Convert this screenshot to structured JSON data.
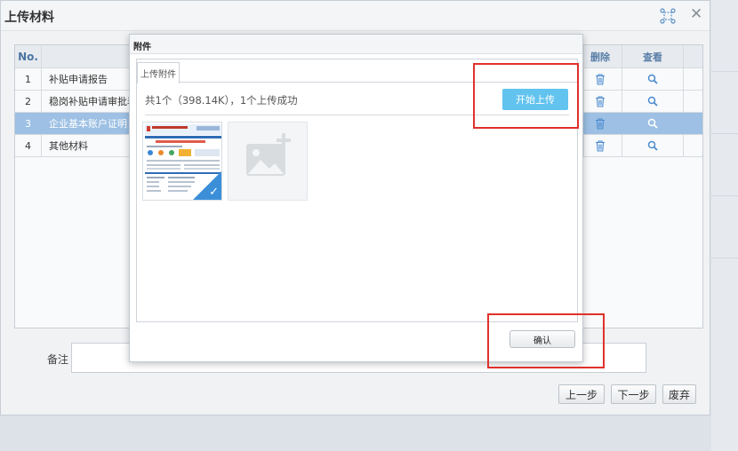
{
  "window": {
    "title": "上传材料"
  },
  "table": {
    "headers": {
      "no": "No.",
      "delete": "删除",
      "view": "查看"
    },
    "rows": [
      {
        "no": "1",
        "name": "补贴申请报告"
      },
      {
        "no": "2",
        "name": "稳岗补贴申请审批表"
      },
      {
        "no": "3",
        "name": "企业基本账户证明"
      },
      {
        "no": "4",
        "name": "其他材料"
      }
    ],
    "selected_row": 3
  },
  "remark": {
    "label": "备注",
    "value": ""
  },
  "buttons": {
    "prev": "上一步",
    "next": "下一步",
    "discard": "废弃"
  },
  "modal": {
    "title": "附件",
    "tab": "上传附件",
    "status": "共1个（398.14K），1个上传成功",
    "start_upload": "开始上传",
    "confirm": "确认"
  },
  "colors": {
    "accent": "#62c3ee",
    "highlight": "#e0312b",
    "selected_row": "#9dc0e4",
    "check": "#3b8fd9"
  },
  "icons": [
    "fit-screen-icon",
    "close-icon",
    "trash-icon",
    "search-icon",
    "add-image-icon",
    "check-icon"
  ]
}
